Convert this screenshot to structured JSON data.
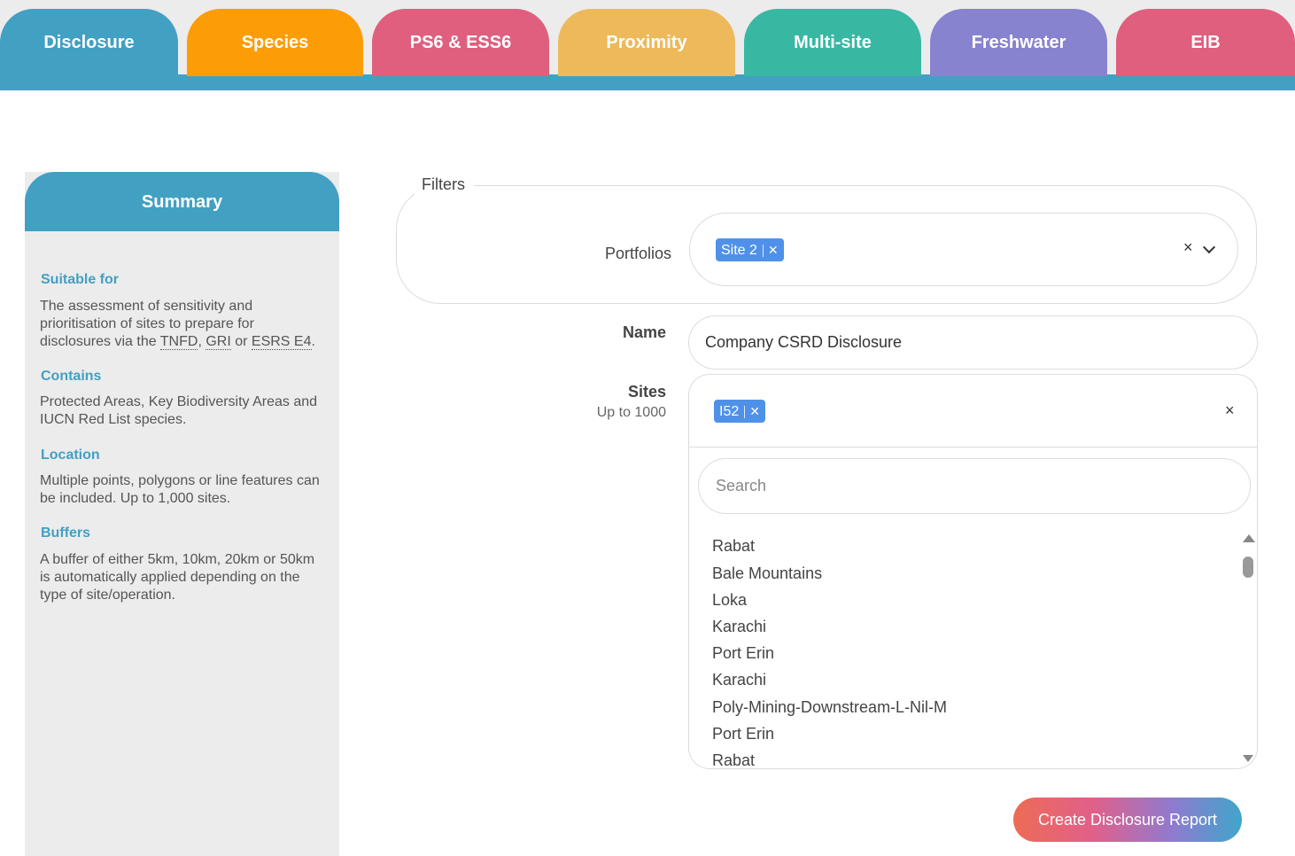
{
  "tabs": [
    {
      "label": "Disclosure",
      "active": true,
      "color": "#42a0c2"
    },
    {
      "label": "Species",
      "color": "#fc9d08"
    },
    {
      "label": "PS6 & ESS6",
      "color": "#e05f7e"
    },
    {
      "label": "Proximity",
      "color": "#edb95a"
    },
    {
      "label": "Multi-site",
      "color": "#38b8a3"
    },
    {
      "label": "Freshwater",
      "color": "#8883cf"
    },
    {
      "label": "EIB",
      "color": "#e05f7e"
    }
  ],
  "summary": {
    "title": "Summary",
    "suitable_for": {
      "heading": "Suitable for",
      "text_before": "The assessment of sensitivity and prioritisation of sites to prepare for disclosures via the ",
      "abbr1": "TNFD",
      "sep1": ", ",
      "abbr2": "GRI",
      "sep2": " or ",
      "abbr3": "ESRS E4",
      "text_after": "."
    },
    "contains": {
      "heading": "Contains",
      "text": "Protected Areas, Key Biodiversity Areas and IUCN Red List species."
    },
    "location": {
      "heading": "Location",
      "text": "Multiple points, polygons or line features can be included. Up to 1,000 sites."
    },
    "buffers": {
      "heading": "Buffers",
      "text": "A buffer of either 5km, 10km, 20km or 50km is automatically applied depending on the type of site/operation."
    }
  },
  "filters": {
    "legend": "Filters",
    "portfolios_label": "Portfolios",
    "portfolios_selected": "Site 2",
    "clear_glyph": "×"
  },
  "name": {
    "label": "Name",
    "value": "Company CSRD Disclosure"
  },
  "sites": {
    "label": "Sites",
    "sublabel": "Up to 1000",
    "selected": "I52",
    "search_placeholder": "Search",
    "options": [
      "Rabat",
      "Bale Mountains",
      "Loka",
      "Karachi",
      "Port Erin",
      "Karachi",
      "Poly-Mining-Downstream-L-Nil-M",
      "Port Erin",
      "Rabat"
    ]
  },
  "cta": {
    "label": "Create Disclosure Report"
  },
  "colors": {
    "accent": "#42a0c2",
    "chip": "#4f91e8"
  }
}
